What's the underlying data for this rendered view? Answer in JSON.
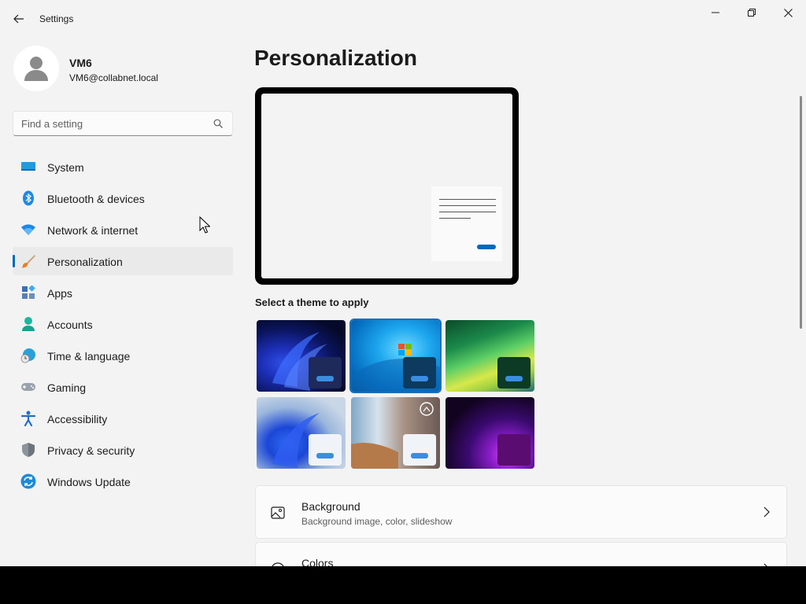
{
  "titlebar": {
    "app_title": "Settings"
  },
  "profile": {
    "name": "VM6",
    "email": "VM6@collabnet.local"
  },
  "search": {
    "placeholder": "Find a setting"
  },
  "sidebar": {
    "items": [
      {
        "label": "System",
        "icon": "system-icon"
      },
      {
        "label": "Bluetooth & devices",
        "icon": "bluetooth-icon"
      },
      {
        "label": "Network & internet",
        "icon": "wifi-icon"
      },
      {
        "label": "Personalization",
        "icon": "paintbrush-icon",
        "selected": true
      },
      {
        "label": "Apps",
        "icon": "apps-icon"
      },
      {
        "label": "Accounts",
        "icon": "account-icon"
      },
      {
        "label": "Time & language",
        "icon": "globe-clock-icon"
      },
      {
        "label": "Gaming",
        "icon": "gamepad-icon"
      },
      {
        "label": "Accessibility",
        "icon": "accessibility-icon"
      },
      {
        "label": "Privacy & security",
        "icon": "shield-icon"
      },
      {
        "label": "Windows Update",
        "icon": "update-icon"
      }
    ]
  },
  "main": {
    "title": "Personalization",
    "themes_label": "Select a theme to apply",
    "themes": [
      {
        "name": "windows-dark-bloom",
        "selected": false
      },
      {
        "name": "windows-7-style",
        "selected": true
      },
      {
        "name": "aurora-green",
        "selected": false
      },
      {
        "name": "windows-light-bloom",
        "selected": false
      },
      {
        "name": "spotlight-nature",
        "selected": false
      },
      {
        "name": "glow-purple",
        "selected": false
      }
    ],
    "cards": [
      {
        "title": "Background",
        "subtitle": "Background image, color, slideshow",
        "icon": "picture-icon"
      },
      {
        "title": "Colors",
        "subtitle": "",
        "icon": "palette-icon"
      }
    ]
  },
  "colors": {
    "accent": "#0067c0",
    "window_bg": "#f3f3f3",
    "selected_nav_bg": "#eaeaea"
  }
}
